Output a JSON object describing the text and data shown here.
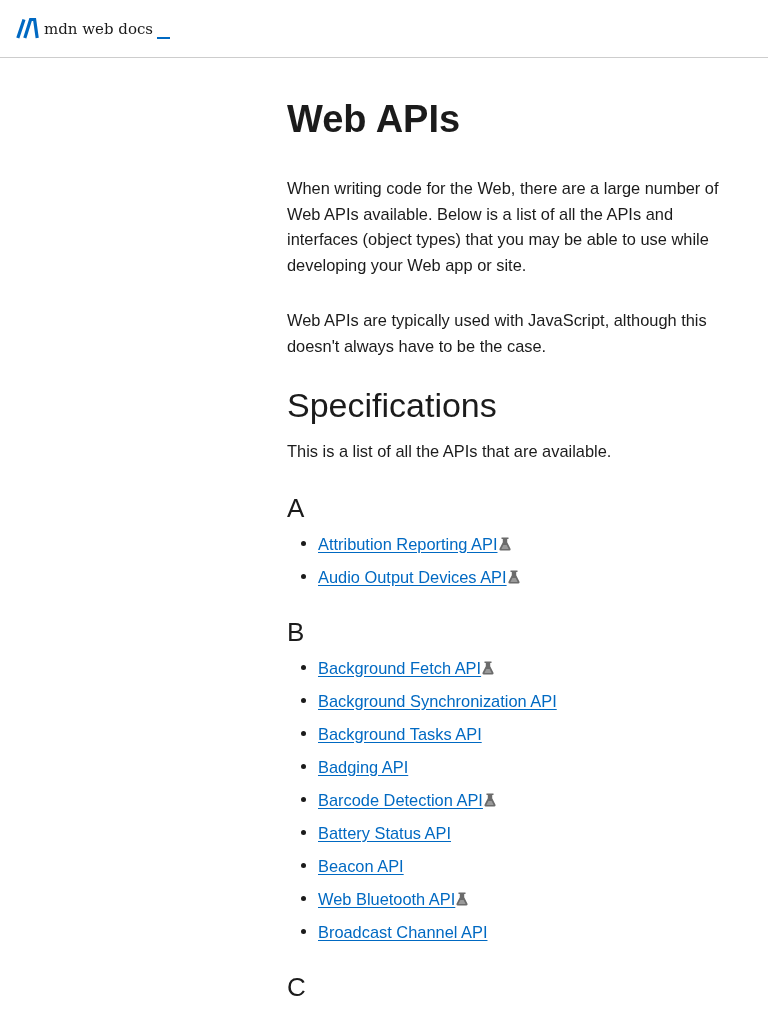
{
  "header": {
    "logo_text": "mdn web docs"
  },
  "title": "Web APIs",
  "intro": [
    "When writing code for the Web, there are a large number of Web APIs available. Below is a list of all the APIs and interfaces (object types) that you may be able to use while developing your Web app or site.",
    "Web APIs are typically used with JavaScript, although this doesn't always have to be the case."
  ],
  "specifications": {
    "heading": "Specifications",
    "text": "This is a list of all the APIs that are available."
  },
  "groups": [
    {
      "letter": "A",
      "items": [
        {
          "label": "Attribution Reporting API",
          "experimental": true
        },
        {
          "label": "Audio Output Devices API",
          "experimental": true
        }
      ]
    },
    {
      "letter": "B",
      "items": [
        {
          "label": "Background Fetch API",
          "experimental": true
        },
        {
          "label": "Background Synchronization API",
          "experimental": false
        },
        {
          "label": "Background Tasks API",
          "experimental": false
        },
        {
          "label": "Badging API",
          "experimental": false
        },
        {
          "label": "Barcode Detection API",
          "experimental": true
        },
        {
          "label": "Battery Status API",
          "experimental": false
        },
        {
          "label": "Beacon API",
          "experimental": false
        },
        {
          "label": "Web Bluetooth API",
          "experimental": true
        },
        {
          "label": "Broadcast Channel API",
          "experimental": false
        }
      ]
    },
    {
      "letter": "C"
    }
  ]
}
